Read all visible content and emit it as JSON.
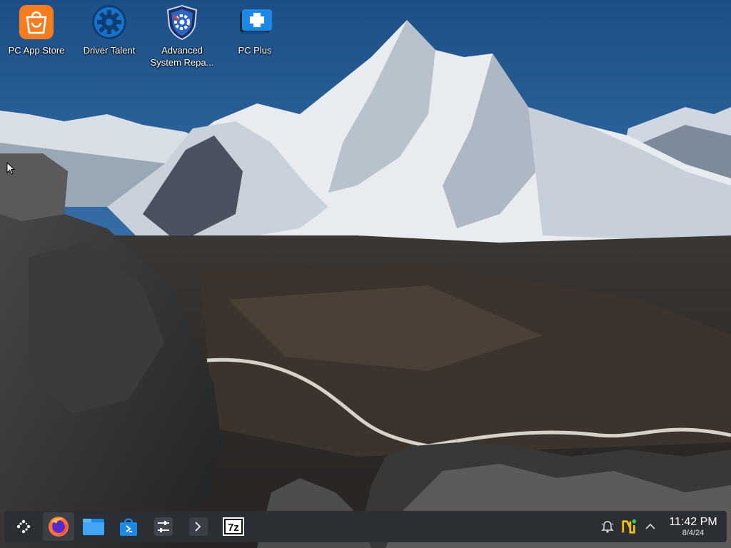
{
  "desktop": {
    "icons": [
      {
        "label": "PC App Store",
        "icon": "shopping-bag-icon"
      },
      {
        "label": "Driver Talent",
        "icon": "gear-icon"
      },
      {
        "label": "Advanced\nSystem Repa...",
        "icon": "shield-gear-icon"
      },
      {
        "label": "PC Plus",
        "icon": "medical-kit-icon"
      }
    ]
  },
  "taskbar": {
    "apps": [
      {
        "name": "application-launcher",
        "icon": "launcher-icon"
      },
      {
        "name": "firefox",
        "icon": "firefox-icon"
      },
      {
        "name": "file-manager",
        "icon": "folder-icon"
      },
      {
        "name": "discover-store",
        "icon": "store-bag-icon"
      },
      {
        "name": "system-settings",
        "icon": "sliders-icon"
      },
      {
        "name": "terminal",
        "icon": "terminal-icon"
      },
      {
        "name": "7zip",
        "icon": "7z-icon",
        "text": "7z"
      }
    ],
    "tray": {
      "icons": [
        "notifications-bell-icon",
        "app-update-icon",
        "expand-tray-chevron-icon"
      ]
    },
    "clock": {
      "time": "11:42 PM",
      "date": "8/4/24"
    }
  },
  "colors": {
    "taskbar_bg": "#2b2e33",
    "accent_blue": "#1e88e5",
    "store_orange": "#f57c1f"
  }
}
